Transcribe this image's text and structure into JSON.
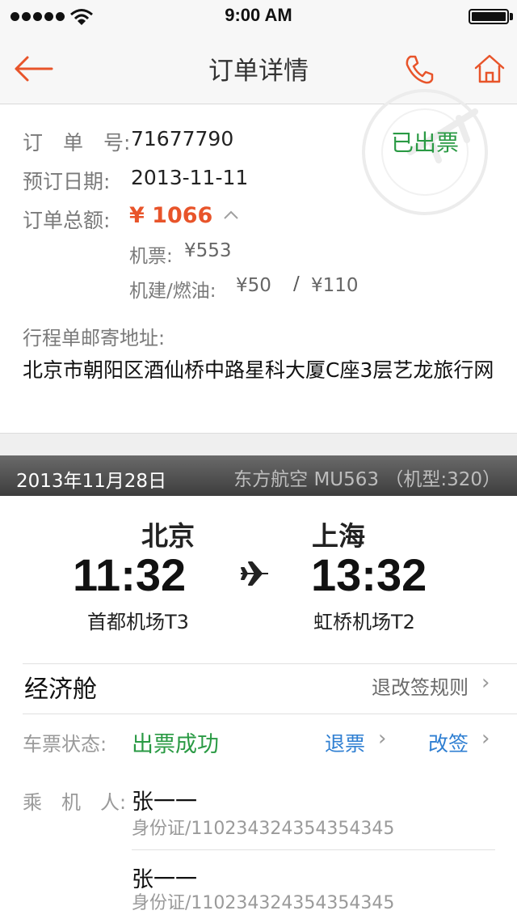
{
  "status_bar": {
    "time": "9:00 AM"
  },
  "nav": {
    "title": "订单详情",
    "back_icon": "back-arrow-icon",
    "phone_icon": "phone-icon",
    "home_icon": "home-icon",
    "accent_color": "#e8542a"
  },
  "order": {
    "order_no_label": "订　单　号:",
    "order_no": "71677790",
    "booking_date_label": "预订日期:",
    "booking_date": "2013-11-11",
    "total_label": "订单总额:",
    "total": "¥ 1066",
    "ticket_label": "机票:",
    "ticket_price": "¥553",
    "tax_label": "机建/燃油:",
    "tax_airport": "¥50",
    "tax_separator": "/",
    "tax_fuel": "¥110",
    "status_stamp": "已出票",
    "address_label": "行程单邮寄地址:",
    "address": "北京市朝阳区酒仙桥中路星科大厦C座3层艺龙旅行网"
  },
  "flight": {
    "date": "2013年11月28日",
    "airline": "东方航空 MU563 （机型:320）",
    "depart_city": "北京",
    "depart_time": "11:32",
    "depart_airport": "首都机场T3",
    "arrive_city": "上海",
    "arrive_time": "13:32",
    "arrive_airport": "虹桥机场T2",
    "cabin": "经济舱",
    "rules_link": "退改签规则",
    "ticket_status_label": "车票状态:",
    "ticket_status": "出票成功",
    "refund_link": "退票",
    "change_link": "改签",
    "passenger_label": "乘　机　人:",
    "passengers": [
      {
        "name": "张一一",
        "id": "身份证/110234324354354345"
      },
      {
        "name": "张一一",
        "id": "身份证/110234324354354345"
      }
    ]
  }
}
